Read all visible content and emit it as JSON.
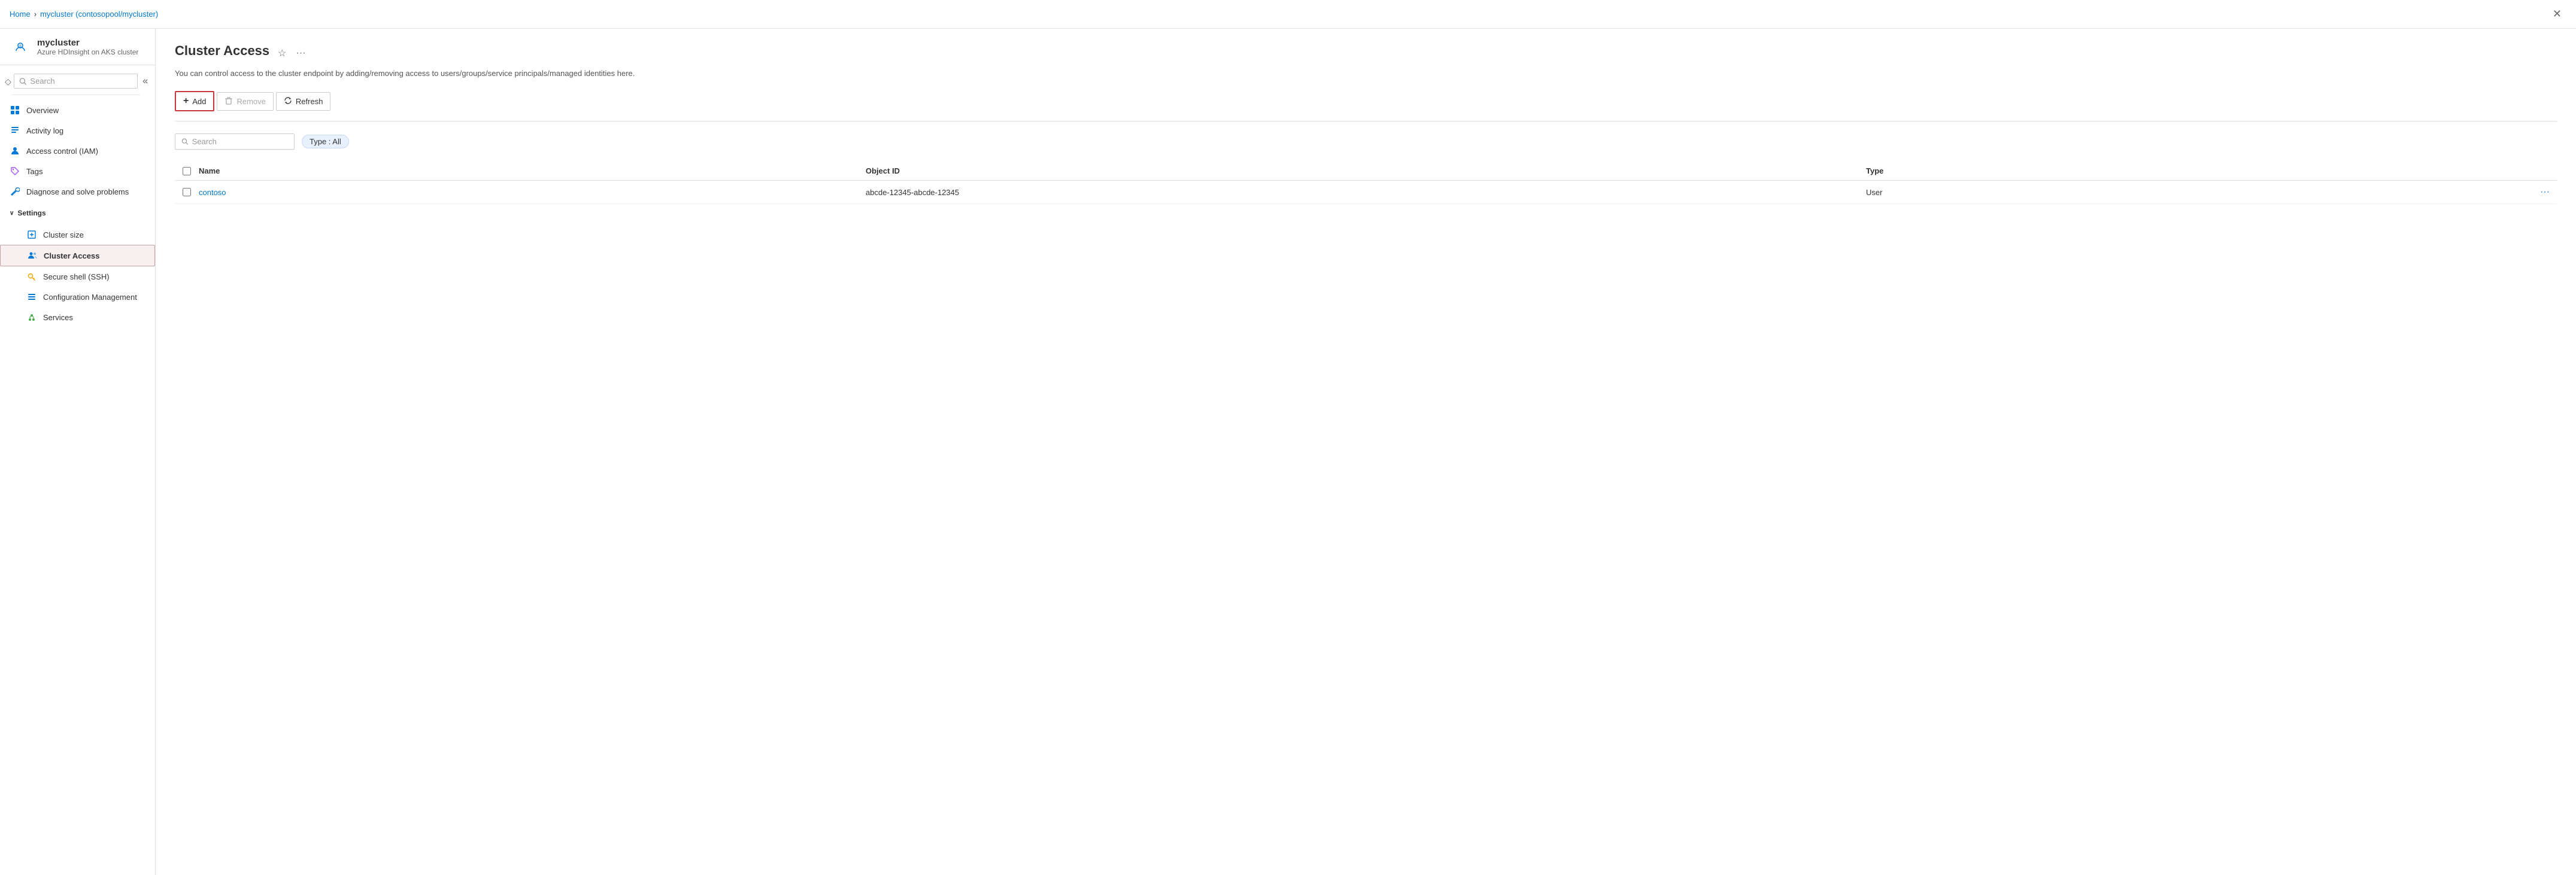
{
  "breadcrumb": {
    "home": "Home",
    "cluster": "mycluster (contosopool/mycluster)"
  },
  "header": {
    "title": "mycluster (contosopool/mycluster) | Cluster Access",
    "subtitle": "Azure HDInsight on AKS cluster",
    "icon_label": "cluster-access-icon"
  },
  "sidebar": {
    "search_placeholder": "Search",
    "nav_items": [
      {
        "id": "overview",
        "label": "Overview",
        "icon": "grid-icon"
      },
      {
        "id": "activity-log",
        "label": "Activity log",
        "icon": "list-icon"
      },
      {
        "id": "access-control",
        "label": "Access control (IAM)",
        "icon": "person-icon"
      },
      {
        "id": "tags",
        "label": "Tags",
        "icon": "tag-icon"
      },
      {
        "id": "diagnose",
        "label": "Diagnose and solve problems",
        "icon": "wrench-icon"
      }
    ],
    "settings_section": "Settings",
    "settings_items": [
      {
        "id": "cluster-size",
        "label": "Cluster size",
        "icon": "resize-icon"
      },
      {
        "id": "cluster-access",
        "label": "Cluster Access",
        "icon": "people-icon",
        "active": true
      },
      {
        "id": "ssh",
        "label": "Secure shell (SSH)",
        "icon": "key-icon"
      },
      {
        "id": "config-mgmt",
        "label": "Configuration Management",
        "icon": "config-icon"
      },
      {
        "id": "services",
        "label": "Services",
        "icon": "services-icon"
      }
    ]
  },
  "main": {
    "page_title": "Cluster Access",
    "page_desc": "You can control access to the cluster endpoint by adding/removing access to users/groups/service principals/managed identities here.",
    "toolbar": {
      "add_label": "Add",
      "remove_label": "Remove",
      "refresh_label": "Refresh"
    },
    "filter": {
      "search_placeholder": "Search",
      "type_filter_label": "Type : All"
    },
    "table": {
      "columns": [
        "Name",
        "Object ID",
        "Type"
      ],
      "rows": [
        {
          "name": "contoso",
          "object_id": "abcde-12345-abcde-12345",
          "type": "User"
        }
      ]
    }
  }
}
